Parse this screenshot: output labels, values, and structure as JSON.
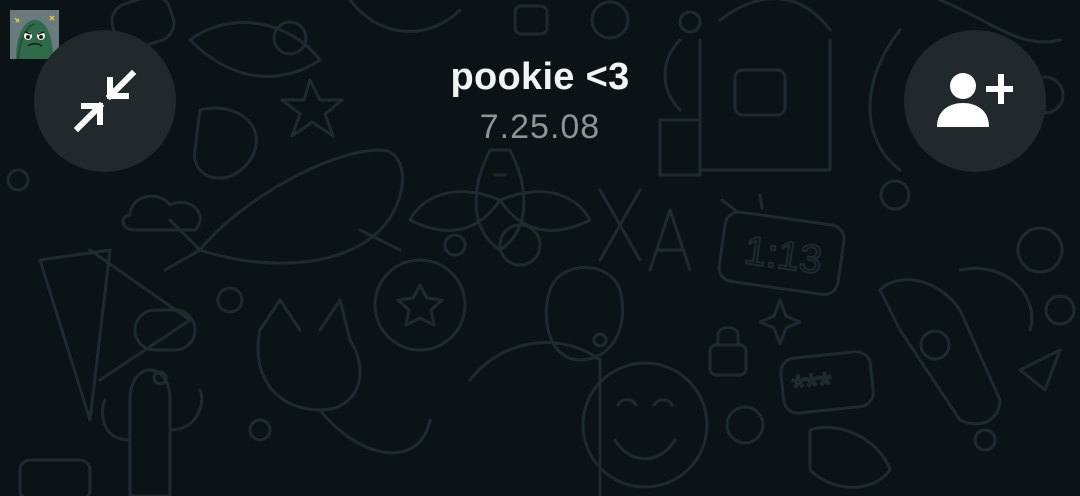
{
  "call": {
    "contact_name": "pookie <3",
    "subtitle": "7.25.08"
  },
  "controls": {
    "minimize_icon": "minimize-icon",
    "add_participant_icon": "add-person-icon"
  },
  "pip": {
    "avatar_icon": "cactus-avatar-icon"
  },
  "wallpaper": {
    "clock_text": "1:13",
    "code_text": "***"
  },
  "colors": {
    "background": "#0c1317",
    "button": "#22292d",
    "title_text": "#f1f3f4",
    "subtitle_text": "#8b9599",
    "pattern": "#1f2a30"
  }
}
